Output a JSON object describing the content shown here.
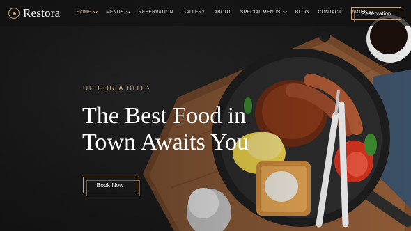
{
  "brand": {
    "name": "Restora",
    "logo_icon": "ring-logo-icon",
    "accent": "#c5a47e"
  },
  "nav": {
    "items": [
      {
        "label": "HOME",
        "dropdown": true,
        "active": true
      },
      {
        "label": "MENUS",
        "dropdown": true,
        "active": false
      },
      {
        "label": "RESERVATION",
        "dropdown": false,
        "active": false
      },
      {
        "label": "GALLERY",
        "dropdown": false,
        "active": false
      },
      {
        "label": "ABOUT",
        "dropdown": false,
        "active": false
      },
      {
        "label": "SPECIAL MENUS",
        "dropdown": true,
        "active": false
      },
      {
        "label": "BLOG",
        "dropdown": false,
        "active": false
      },
      {
        "label": "CONTACT",
        "dropdown": false,
        "active": false
      },
      {
        "label": "PAGES",
        "dropdown": true,
        "active": false
      }
    ],
    "cta_label": "Reservation"
  },
  "hero": {
    "eyebrow": "UP FOR A BITE?",
    "headline_line1": "The Best Food in",
    "headline_line2": "Town Awaits You",
    "button_label": "Book Now",
    "image": "breakfast-pan-photo"
  }
}
